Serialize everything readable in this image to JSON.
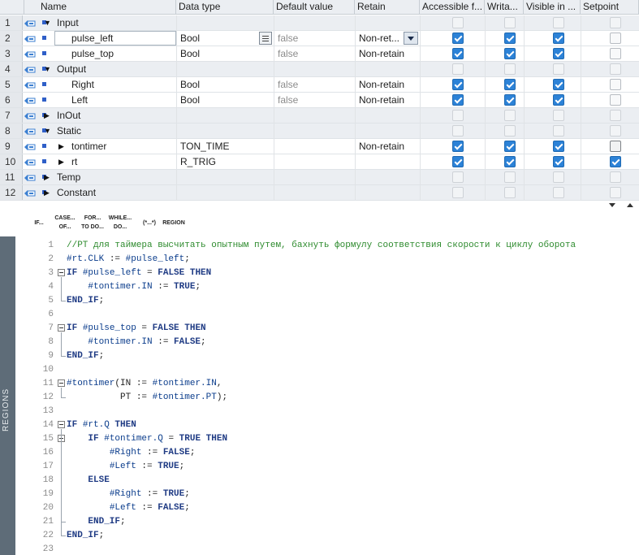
{
  "columns": {
    "name": "Name",
    "datatype": "Data type",
    "default": "Default value",
    "retain": "Retain",
    "accessible": "Accessible f...",
    "writable": "Writa...",
    "visible": "Visible in ...",
    "setpoint": "Setpoint"
  },
  "rows": [
    {
      "num": "1",
      "name": "Input",
      "group": true,
      "expand": "▼"
    },
    {
      "num": "2",
      "name": "pulse_left",
      "type": "Bool",
      "def": "false",
      "ret": "Non-ret...",
      "acc": true,
      "wr": true,
      "vis": true,
      "sp": false,
      "selected": true
    },
    {
      "num": "3",
      "name": "pulse_top",
      "type": "Bool",
      "def": "false",
      "ret": "Non-retain",
      "acc": true,
      "wr": true,
      "vis": true,
      "sp": false
    },
    {
      "num": "4",
      "name": "Output",
      "group": true,
      "expand": "▼"
    },
    {
      "num": "5",
      "name": "Right",
      "type": "Bool",
      "def": "false",
      "ret": "Non-retain",
      "acc": true,
      "wr": true,
      "vis": true,
      "sp": false
    },
    {
      "num": "6",
      "name": "Left",
      "type": "Bool",
      "def": "false",
      "ret": "Non-retain",
      "acc": true,
      "wr": true,
      "vis": true,
      "sp": false
    },
    {
      "num": "7",
      "name": "InOut",
      "group": true,
      "expand": "▶"
    },
    {
      "num": "8",
      "name": "Static",
      "group": true,
      "expand": "▼"
    },
    {
      "num": "9",
      "name": "tontimer",
      "type": "TON_TIME",
      "def": "",
      "ret": "Non-retain",
      "acc": true,
      "wr": true,
      "vis": true,
      "sp": false,
      "sub": "▶",
      "spdark": true
    },
    {
      "num": "10",
      "name": "rt",
      "type": "R_TRIG",
      "def": "",
      "ret": "",
      "acc": true,
      "wr": true,
      "vis": true,
      "sp": true,
      "sub": "▶"
    },
    {
      "num": "11",
      "name": "Temp",
      "group": true,
      "expand": "▶"
    },
    {
      "num": "12",
      "name": "Constant",
      "group": true,
      "expand": "▶"
    }
  ],
  "toolbar": [
    {
      "l1": "IF...",
      "l2": ""
    },
    {
      "l1": "CASE...",
      "l2": "OF..."
    },
    {
      "l1": "FOR...",
      "l2": "TO DO..."
    },
    {
      "l1": "WHILE...",
      "l2": "DO..."
    },
    {
      "l1": "(*...*)",
      "l2": ""
    },
    {
      "l1": "REGION",
      "l2": ""
    }
  ],
  "regions_label": "REGIONS",
  "code": [
    {
      "n": "1",
      "parts": [
        [
          "c-com",
          "//PT для таймера высчитать опытным путем, бахнуть формулу соответствия скорости к циклу оборота"
        ]
      ]
    },
    {
      "n": "2",
      "parts": [
        [
          "c-var",
          "#rt.CLK"
        ],
        [
          "c-op",
          " := "
        ],
        [
          "c-var",
          "#pulse_left"
        ],
        [
          "c-op",
          ";"
        ]
      ]
    },
    {
      "n": "3",
      "fold": true,
      "parts": [
        [
          "c-kw",
          "IF "
        ],
        [
          "c-var",
          "#pulse_left"
        ],
        [
          "c-op",
          " = "
        ],
        [
          "c-kw",
          "FALSE THEN"
        ]
      ]
    },
    {
      "n": "4",
      "parts": [
        [
          "c-op",
          "    "
        ],
        [
          "c-var",
          "#tontimer.IN"
        ],
        [
          "c-op",
          " := "
        ],
        [
          "c-kw",
          "TRUE"
        ],
        [
          "c-op",
          ";"
        ]
      ]
    },
    {
      "n": "5",
      "end": true,
      "parts": [
        [
          "c-kw",
          "END_IF"
        ],
        [
          "c-op",
          ";"
        ]
      ]
    },
    {
      "n": "6",
      "parts": []
    },
    {
      "n": "7",
      "fold": true,
      "parts": [
        [
          "c-kw",
          "IF "
        ],
        [
          "c-var",
          "#pulse_top"
        ],
        [
          "c-op",
          " = "
        ],
        [
          "c-kw",
          "FALSE THEN"
        ]
      ]
    },
    {
      "n": "8",
      "parts": [
        [
          "c-op",
          "    "
        ],
        [
          "c-var",
          "#tontimer.IN"
        ],
        [
          "c-op",
          " := "
        ],
        [
          "c-kw",
          "FALSE"
        ],
        [
          "c-op",
          ";"
        ]
      ]
    },
    {
      "n": "9",
      "end": true,
      "parts": [
        [
          "c-kw",
          "END_IF"
        ],
        [
          "c-op",
          ";"
        ]
      ]
    },
    {
      "n": "10",
      "parts": []
    },
    {
      "n": "11",
      "fold": true,
      "parts": [
        [
          "c-var",
          "#tontimer"
        ],
        [
          "c-op",
          "(IN := "
        ],
        [
          "c-var",
          "#tontimer.IN"
        ],
        [
          "c-op",
          ","
        ]
      ]
    },
    {
      "n": "12",
      "end": true,
      "parts": [
        [
          "c-op",
          "          PT := "
        ],
        [
          "c-var",
          "#tontimer.PT"
        ],
        [
          "c-op",
          ");"
        ]
      ]
    },
    {
      "n": "13",
      "parts": []
    },
    {
      "n": "14",
      "fold": true,
      "parts": [
        [
          "c-kw",
          "IF "
        ],
        [
          "c-var",
          "#rt.Q"
        ],
        [
          "c-kw",
          " THEN"
        ]
      ]
    },
    {
      "n": "15",
      "fold": true,
      "parts": [
        [
          "c-op",
          "    "
        ],
        [
          "c-kw",
          "IF "
        ],
        [
          "c-var",
          "#tontimer.Q"
        ],
        [
          "c-op",
          " = "
        ],
        [
          "c-kw",
          "TRUE THEN"
        ]
      ]
    },
    {
      "n": "16",
      "parts": [
        [
          "c-op",
          "        "
        ],
        [
          "c-var",
          "#Right"
        ],
        [
          "c-op",
          " := "
        ],
        [
          "c-kw",
          "FALSE"
        ],
        [
          "c-op",
          ";"
        ]
      ]
    },
    {
      "n": "17",
      "parts": [
        [
          "c-op",
          "        "
        ],
        [
          "c-var",
          "#Left"
        ],
        [
          "c-op",
          " := "
        ],
        [
          "c-kw",
          "TRUE"
        ],
        [
          "c-op",
          ";"
        ]
      ]
    },
    {
      "n": "18",
      "parts": [
        [
          "c-op",
          "    "
        ],
        [
          "c-kw",
          "ELSE"
        ]
      ]
    },
    {
      "n": "19",
      "parts": [
        [
          "c-op",
          "        "
        ],
        [
          "c-var",
          "#Right"
        ],
        [
          "c-op",
          " := "
        ],
        [
          "c-kw",
          "TRUE"
        ],
        [
          "c-op",
          ";"
        ]
      ]
    },
    {
      "n": "20",
      "parts": [
        [
          "c-op",
          "        "
        ],
        [
          "c-var",
          "#Left"
        ],
        [
          "c-op",
          " := "
        ],
        [
          "c-kw",
          "FALSE"
        ],
        [
          "c-op",
          ";"
        ]
      ]
    },
    {
      "n": "21",
      "parts": [
        [
          "c-op",
          "    "
        ],
        [
          "c-kw",
          "END_IF"
        ],
        [
          "c-op",
          ";"
        ]
      ]
    },
    {
      "n": "22",
      "end": true,
      "parts": [
        [
          "c-kw",
          "END_IF"
        ],
        [
          "c-op",
          ";"
        ]
      ]
    },
    {
      "n": "23",
      "parts": []
    }
  ]
}
